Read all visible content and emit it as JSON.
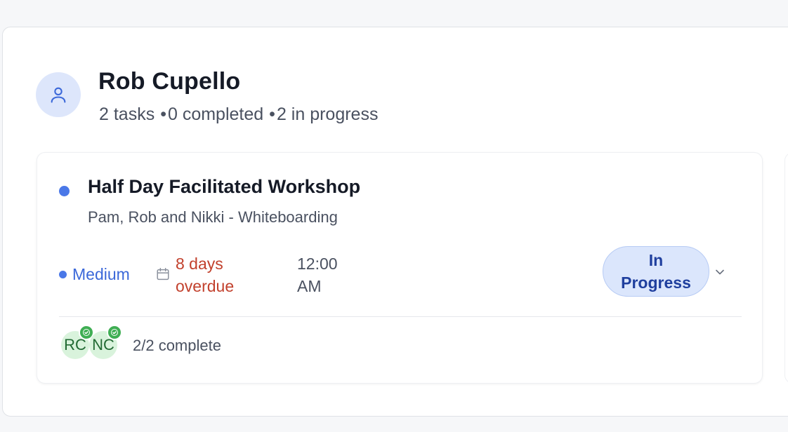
{
  "person": {
    "name": "Rob Cupello",
    "stats": {
      "tasks": "2 tasks",
      "completed": "0 completed",
      "in_progress": "2 in progress",
      "separator": "•"
    }
  },
  "task": {
    "title": "Half Day Facilitated Workshop",
    "description": "Pam, Rob and Nikki - Whiteboarding",
    "priority": "Medium",
    "due_status": "8 days overdue",
    "time": "12:00 AM",
    "status": "In Progress",
    "assignees": [
      {
        "initials": "RC",
        "done": true
      },
      {
        "initials": "NC",
        "done": true
      }
    ],
    "completion": "2/2 complete"
  },
  "colors": {
    "accent_blue": "#4a78e8",
    "overdue_red": "#c2412d",
    "status_bg": "#dbe6fc",
    "assignee_bg": "#d9f3dc",
    "check_green": "#3fae53"
  },
  "icons": {
    "avatar": "user-icon",
    "due": "calendar-icon",
    "status_toggle": "chevron-down-icon",
    "assignee_done": "check-circle-icon"
  }
}
